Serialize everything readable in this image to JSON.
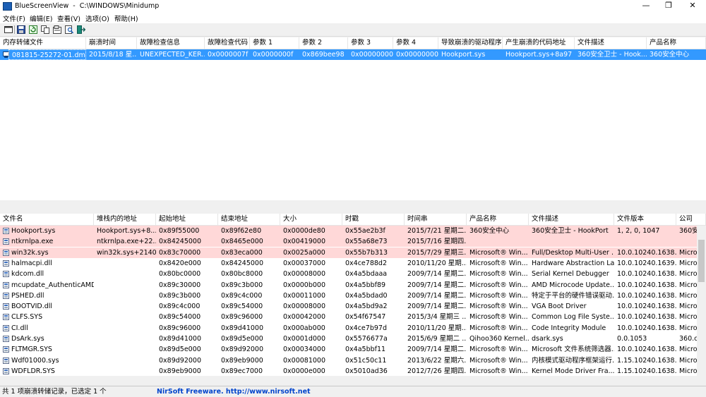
{
  "titlebar": {
    "title": "BlueScreenView  -  C:\\WINDOWS\\Minidump",
    "minimize": "—",
    "maximize": "❐",
    "close": "✕"
  },
  "menu": [
    "文件(F)",
    "编辑(E)",
    "查看(V)",
    "选项(O)",
    "帮助(H)"
  ],
  "top": {
    "headers": [
      "内存转储文件",
      "崩溃时间",
      "故障检查信息",
      "故障检查代码",
      "参数 1",
      "参数 2",
      "参数 3",
      "参数 4",
      "导致崩溃的驱动程序",
      "产生崩溃的代码地址",
      "文件描述",
      "产品名称"
    ],
    "rows": [
      [
        "081815-25272-01.dmp",
        "2015/8/18 星...",
        "UNEXPECTED_KER...",
        "0x0000007f",
        "0x0000000f",
        "0x869bee98",
        "0x00000000",
        "0x00000000",
        "Hookport.sys",
        "Hookport.sys+8a97",
        "360安全卫士 - Hook...",
        "360安全中心"
      ]
    ]
  },
  "bottom": {
    "headers": [
      "文件名",
      "堆栈内的地址",
      "起始地址",
      "结束地址",
      "大小",
      "时戳",
      "时间串",
      "产品名称",
      "文件描述",
      "文件版本",
      "公司"
    ],
    "rows": [
      [
        "Hookport.sys",
        "Hookport.sys+8...",
        "0x89f55000",
        "0x89f62e80",
        "0x0000de80",
        "0x55ae2b3f",
        "2015/7/21 星期二...",
        "360安全中心",
        "360安全卫士 - HookPort",
        "1, 2, 0, 1047",
        "360安"
      ],
      [
        "ntkrnlpa.exe",
        "ntkrnlpa.exe+22...",
        "0x84245000",
        "0x8465e000",
        "0x00419000",
        "0x55a68e73",
        "2015/7/16 星期四...",
        "",
        "",
        "",
        ""
      ],
      [
        "win32k.sys",
        "win32k.sys+2140...",
        "0x83c70000",
        "0x83eca000",
        "0x0025a000",
        "0x55b7b313",
        "2015/7/29 星期三...",
        "Microsoft® Win...",
        "Full/Desktop Multi-User ...",
        "10.0.10240.1638...",
        "Micro"
      ],
      [
        "halmacpi.dll",
        "",
        "0x8420e000",
        "0x84245000",
        "0x00037000",
        "0x4ce788d2",
        "2010/11/20 星期...",
        "Microsoft® Win...",
        "Hardware Abstraction La...",
        "10.0.10240.1639...",
        "Micro"
      ],
      [
        "kdcom.dll",
        "",
        "0x80bc0000",
        "0x80bc8000",
        "0x00008000",
        "0x4a5bdaaa",
        "2009/7/14 星期二...",
        "Microsoft® Win...",
        "Serial Kernel Debugger",
        "10.0.10240.1638...",
        "Micro"
      ],
      [
        "mcupdate_AuthenticAMD....",
        "",
        "0x89c30000",
        "0x89c3b000",
        "0x0000b000",
        "0x4a5bbf89",
        "2009/7/14 星期二...",
        "Microsoft® Win...",
        "AMD Microcode Update...",
        "10.0.10240.1638...",
        "Micro"
      ],
      [
        "PSHED.dll",
        "",
        "0x89c3b000",
        "0x89c4c000",
        "0x00011000",
        "0x4a5bdad0",
        "2009/7/14 星期二...",
        "Microsoft® Win...",
        "特定于平台的硬件错误驱动...",
        "10.0.10240.1638...",
        "Micro"
      ],
      [
        "BOOTVID.dll",
        "",
        "0x89c4c000",
        "0x89c54000",
        "0x00008000",
        "0x4a5bd9a2",
        "2009/7/14 星期二...",
        "Microsoft® Win...",
        "VGA Boot Driver",
        "10.0.10240.1638...",
        "Micro"
      ],
      [
        "CLFS.SYS",
        "",
        "0x89c54000",
        "0x89c96000",
        "0x00042000",
        "0x54f67547",
        "2015/3/4 星期三 ...",
        "Microsoft® Win...",
        "Common Log File Syste...",
        "10.0.10240.1638...",
        "Micro"
      ],
      [
        "CI.dll",
        "",
        "0x89c96000",
        "0x89d41000",
        "0x000ab000",
        "0x4ce7b97d",
        "2010/11/20 星期...",
        "Microsoft® Win...",
        "Code Integrity Module",
        "10.0.10240.1638...",
        "Micro"
      ],
      [
        "DsArk.sys",
        "",
        "0x89d41000",
        "0x89d5e000",
        "0x0001d000",
        "0x5576677a",
        "2015/6/9 星期二 ...",
        "Qihoo360 Kernel...",
        "dsark.sys",
        "0.0.1053",
        "360.cn"
      ],
      [
        "FLTMGR.SYS",
        "",
        "0x89d5e000",
        "0x89d92000",
        "0x00034000",
        "0x4a5bbf11",
        "2009/7/14 星期二...",
        "Microsoft® Win...",
        "Microsoft 文件系统筛选器...",
        "10.0.10240.1638...",
        "Micro"
      ],
      [
        "Wdf01000.sys",
        "",
        "0x89d92000",
        "0x89eb9000",
        "0x00081000",
        "0x51c50c11",
        "2013/6/22 星期六...",
        "Microsoft® Win...",
        "内核模式驱动程序框架运行...",
        "1.15.10240.1638...",
        "Micro"
      ],
      [
        "WDFLDR.SYS",
        "",
        "0x89eb9000",
        "0x89ec7000",
        "0x0000e000",
        "0x5010ad36",
        "2012/7/26 星期四...",
        "Microsoft® Win...",
        "Kernel Mode Driver Fra...",
        "1.15.10240.1638...",
        "Micro"
      ]
    ],
    "highlight_rows": [
      0,
      1,
      2
    ]
  },
  "status": {
    "count": "共 1 项崩溃转储记录，已选定 1 个",
    "link": "NirSoft Freeware.  http://www.nirsoft.net"
  },
  "colors": {
    "selection": "#3399ff",
    "highlight": "#ffd8d8",
    "link": "#0044cc"
  }
}
